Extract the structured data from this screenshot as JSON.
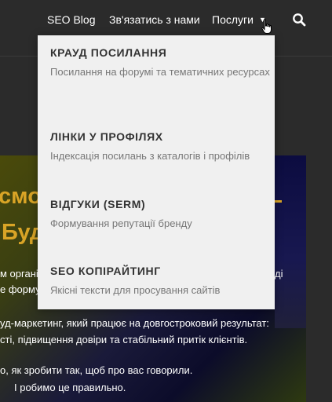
{
  "nav": {
    "items": [
      {
        "label": "SEO Blog"
      },
      {
        "label": "Зв'язатись з нами"
      },
      {
        "label": "Послуги"
      }
    ],
    "search_icon": "search-icon",
    "cursor_icon": "hand-pointer-icon"
  },
  "dropdown": {
    "items": [
      {
        "title": "КРАУД ПОСИЛАННЯ",
        "description": "Посилання на форумі та тематичних ресурсах"
      },
      {
        "title": "ЛІНКИ У ПРОФІЛЯХ",
        "description": "Індексація посилань з каталогів і профілів"
      },
      {
        "title": "ВІДГУКИ (SERM)",
        "description": "Формування репутації бренду"
      },
      {
        "title": "SEO КОПІРАЙТИНГ",
        "description": "Якісні тексти для просування сайтів"
      }
    ]
  },
  "hero": {
    "title_line1": "смо",
    "title_line2": "Буд",
    "lines": [
      "м органі",
      "ді",
      "е форму",
      "уд-маркетинг, який працює на довгостроковий результат:",
      "сті, підвищення довіри та стабільний притік клієнтів.",
      "о, як зробити так, щоб про вас говорили.",
      "І робимо це правильно."
    ]
  },
  "colors": {
    "nav_background": "#2b2b2b",
    "dropdown_background": "#f0f0f0",
    "accent": "#d9a426"
  }
}
